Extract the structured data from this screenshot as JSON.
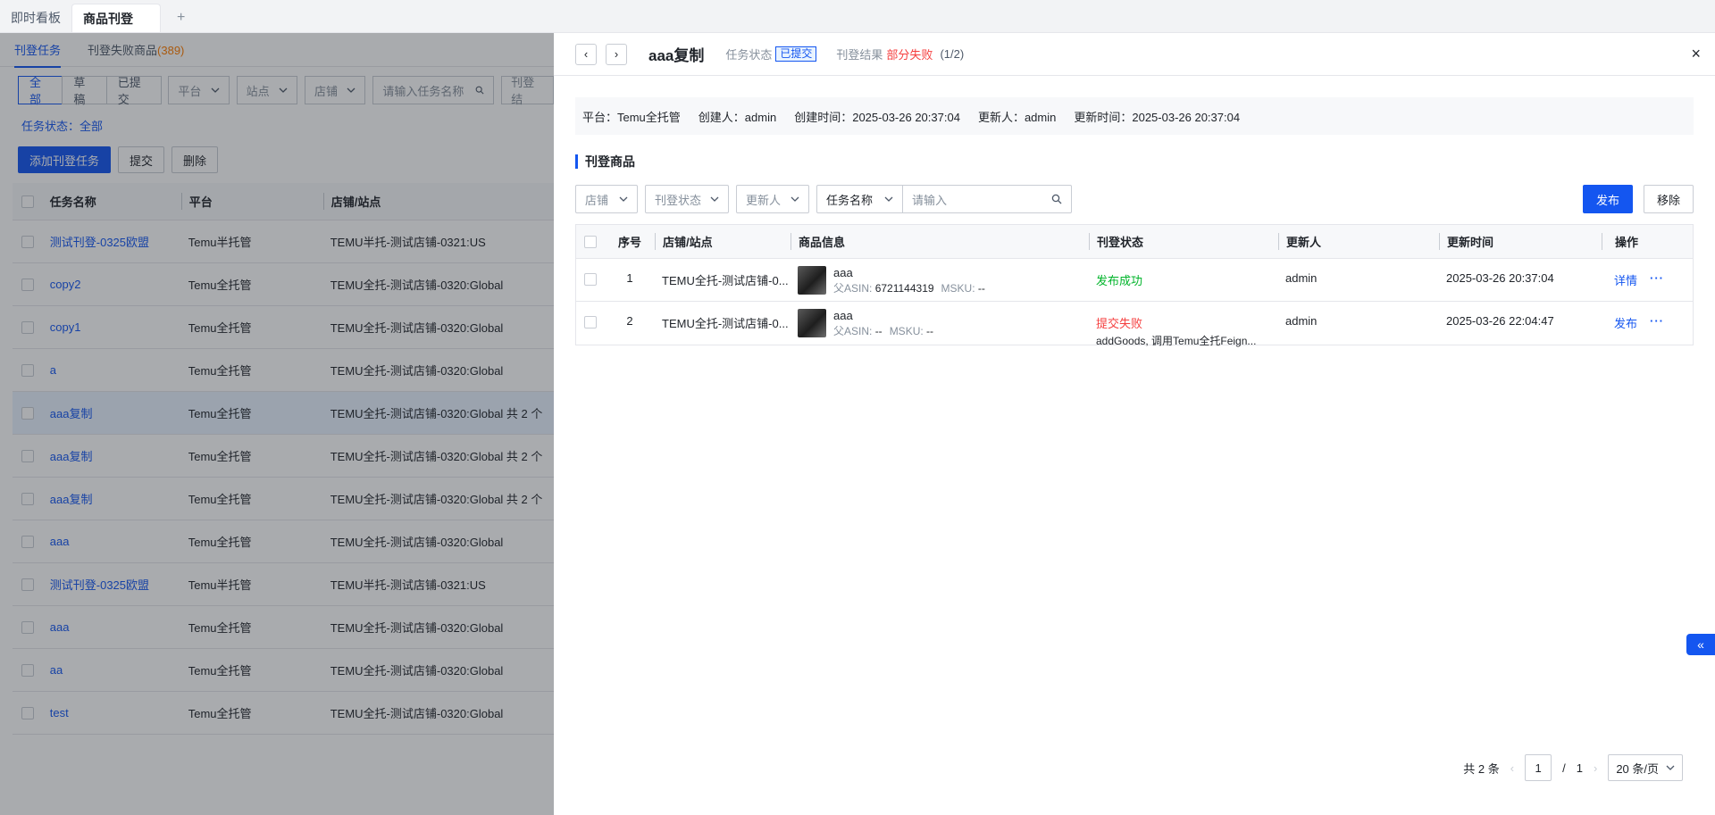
{
  "topbar": {
    "tabs": [
      {
        "label": "即时看板"
      },
      {
        "label": "商品刊登"
      }
    ],
    "add": "+"
  },
  "left": {
    "subtabs": [
      {
        "label": "刊登任务"
      },
      {
        "label": "刊登失败商品",
        "count": "(389)"
      }
    ],
    "segments": [
      "全部",
      "草稿",
      "已提交"
    ],
    "filters": {
      "platform": "平台",
      "site": "站点",
      "shop": "店铺",
      "search_placeholder": "请输入任务名称",
      "more": "刊登结"
    },
    "status_line": "任务状态：全部",
    "actions": {
      "add": "添加刊登任务",
      "submit": "提交",
      "delete": "删除"
    },
    "columns": [
      "任务名称",
      "平台",
      "店铺/站点"
    ],
    "rows": [
      {
        "name": "测试刊登-0325欧盟",
        "platform": "Temu半托管",
        "shop": "TEMU半托-测试店铺-0321:US"
      },
      {
        "name": "copy2",
        "platform": "Temu全托管",
        "shop": "TEMU全托-测试店铺-0320:Global"
      },
      {
        "name": "copy1",
        "platform": "Temu全托管",
        "shop": "TEMU全托-测试店铺-0320:Global"
      },
      {
        "name": "a",
        "platform": "Temu全托管",
        "shop": "TEMU全托-测试店铺-0320:Global"
      },
      {
        "name": "aaa复制",
        "platform": "Temu全托管",
        "shop": "TEMU全托-测试店铺-0320:Global 共 2 个"
      },
      {
        "name": "aaa复制",
        "platform": "Temu全托管",
        "shop": "TEMU全托-测试店铺-0320:Global 共 2 个"
      },
      {
        "name": "aaa复制",
        "platform": "Temu全托管",
        "shop": "TEMU全托-测试店铺-0320:Global 共 2 个"
      },
      {
        "name": "aaa",
        "platform": "Temu全托管",
        "shop": "TEMU全托-测试店铺-0320:Global"
      },
      {
        "name": "测试刊登-0325欧盟",
        "platform": "Temu半托管",
        "shop": "TEMU半托-测试店铺-0321:US"
      },
      {
        "name": "aaa",
        "platform": "Temu全托管",
        "shop": "TEMU全托-测试店铺-0320:Global"
      },
      {
        "name": "aa",
        "platform": "Temu全托管",
        "shop": "TEMU全托-测试店铺-0320:Global"
      },
      {
        "name": "test",
        "platform": "Temu全托管",
        "shop": "TEMU全托-测试店铺-0320:Global"
      }
    ]
  },
  "drawer": {
    "prev": "‹",
    "next": "›",
    "title": "aaa复制",
    "status_label": "任务状态",
    "status_value": "已提交",
    "result_label": "刊登结果",
    "result_value": "部分失败",
    "result_count": "(1/2)",
    "close": "×",
    "info": {
      "platform": "平台：Temu全托管",
      "creator": "创建人：admin",
      "created_at": "创建时间：2025-03-26 20:37:04",
      "updater": "更新人：admin",
      "updated_at": "更新时间：2025-03-26 20:37:04"
    },
    "section_title": "刊登商品",
    "filters": {
      "shop": "店铺",
      "status": "刊登状态",
      "updater": "更新人",
      "field": "任务名称",
      "placeholder": "请输入"
    },
    "buttons": {
      "publish": "发布",
      "remove": "移除"
    },
    "columns": [
      "序号",
      "店铺/站点",
      "商品信息",
      "刊登状态",
      "更新人",
      "更新时间",
      "操作"
    ],
    "rows": [
      {
        "index": "1",
        "shop": "TEMU全托-测试店铺-0...",
        "product": "aaa",
        "asin_label": "父ASIN:",
        "asin": "6721144319",
        "msku_label": "MSKU:",
        "msku": "--",
        "status": "发布成功",
        "status_type": "success",
        "error": "",
        "updater": "admin",
        "updated_at": "2025-03-26 20:37:04",
        "action": "详情",
        "more": "···"
      },
      {
        "index": "2",
        "shop": "TEMU全托-测试店铺-0...",
        "product": "aaa",
        "asin_label": "父ASIN:",
        "asin": "--",
        "msku_label": "MSKU:",
        "msku": "--",
        "status": "提交失败",
        "status_type": "failed",
        "error": "addGoods, 调用Temu全托Feign...",
        "updater": "admin",
        "updated_at": "2025-03-26 22:04:47",
        "action": "发布",
        "more": "···"
      }
    ],
    "pagination": {
      "total": "共 2 条",
      "page": "1",
      "sep": "/",
      "pages": "1",
      "page_size": "20 条/页"
    },
    "collapse": "«"
  },
  "colors": {
    "primary": "#1456f0",
    "success": "#00b42a",
    "danger": "#f53f3f",
    "warning": "#ff7d00"
  }
}
